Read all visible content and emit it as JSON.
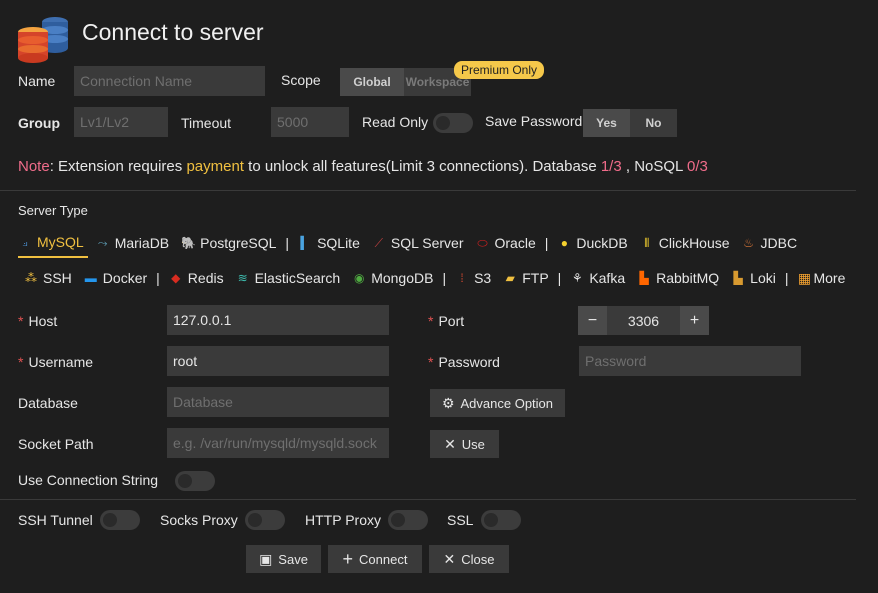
{
  "title": "Connect to server",
  "name": {
    "label": "Name",
    "placeholder": "Connection Name"
  },
  "scope": {
    "label": "Scope",
    "options": [
      "Global",
      "Workspace"
    ],
    "badge": "Premium Only"
  },
  "group": {
    "label": "Group",
    "placeholder": "Lv1/Lv2"
  },
  "timeout": {
    "label": "Timeout",
    "placeholder": "5000"
  },
  "read_only": {
    "label": "Read Only"
  },
  "save_password": {
    "label": "Save Password",
    "options": [
      "Yes",
      "No"
    ]
  },
  "note": {
    "prefix": "Note",
    "text1": ": Extension requires ",
    "payment": "payment",
    "text2": " to unlock all features(Limit 3 connections). Database ",
    "db_count": "1/3",
    "text3": " , NoSQL ",
    "nosql_count": "0/3"
  },
  "server_type": {
    "label": "Server Type",
    "row1": [
      "MySQL",
      "MariaDB",
      "PostgreSQL",
      "SQLite",
      "SQL Server",
      "Oracle",
      "DuckDB",
      "ClickHouse",
      "JDBC"
    ],
    "row2": [
      "SSH",
      "Docker",
      "Redis",
      "ElasticSearch",
      "MongoDB",
      "S3",
      "FTP",
      "Kafka",
      "RabbitMQ",
      "Loki",
      "More"
    ],
    "separator": "|"
  },
  "host": {
    "label": "Host",
    "value": "127.0.0.1"
  },
  "port": {
    "label": "Port",
    "value": "3306",
    "minus": "−",
    "plus": "+"
  },
  "username": {
    "label": "Username",
    "value": "root"
  },
  "password": {
    "label": "Password",
    "placeholder": "Password"
  },
  "database": {
    "label": "Database",
    "placeholder": "Database"
  },
  "advance_option": {
    "label": "Advance Option"
  },
  "socket_path": {
    "label": "Socket Path",
    "placeholder": "e.g. /var/run/mysqld/mysqld.sock"
  },
  "use_button": {
    "label": "Use"
  },
  "use_connection_string": {
    "label": "Use Connection String"
  },
  "ssh_tunnel": {
    "label": "SSH Tunnel"
  },
  "socks_proxy": {
    "label": "Socks Proxy"
  },
  "http_proxy": {
    "label": "HTTP Proxy"
  },
  "ssl": {
    "label": "SSL"
  },
  "actions": {
    "save": "Save",
    "connect": "Connect",
    "close": "Close"
  },
  "required_mark": "*",
  "colors": {
    "note": "#f06c8a",
    "payment": "#f0c040",
    "count": "#f06c8a",
    "active_tab": "#f0c040",
    "required": "#e05252"
  }
}
